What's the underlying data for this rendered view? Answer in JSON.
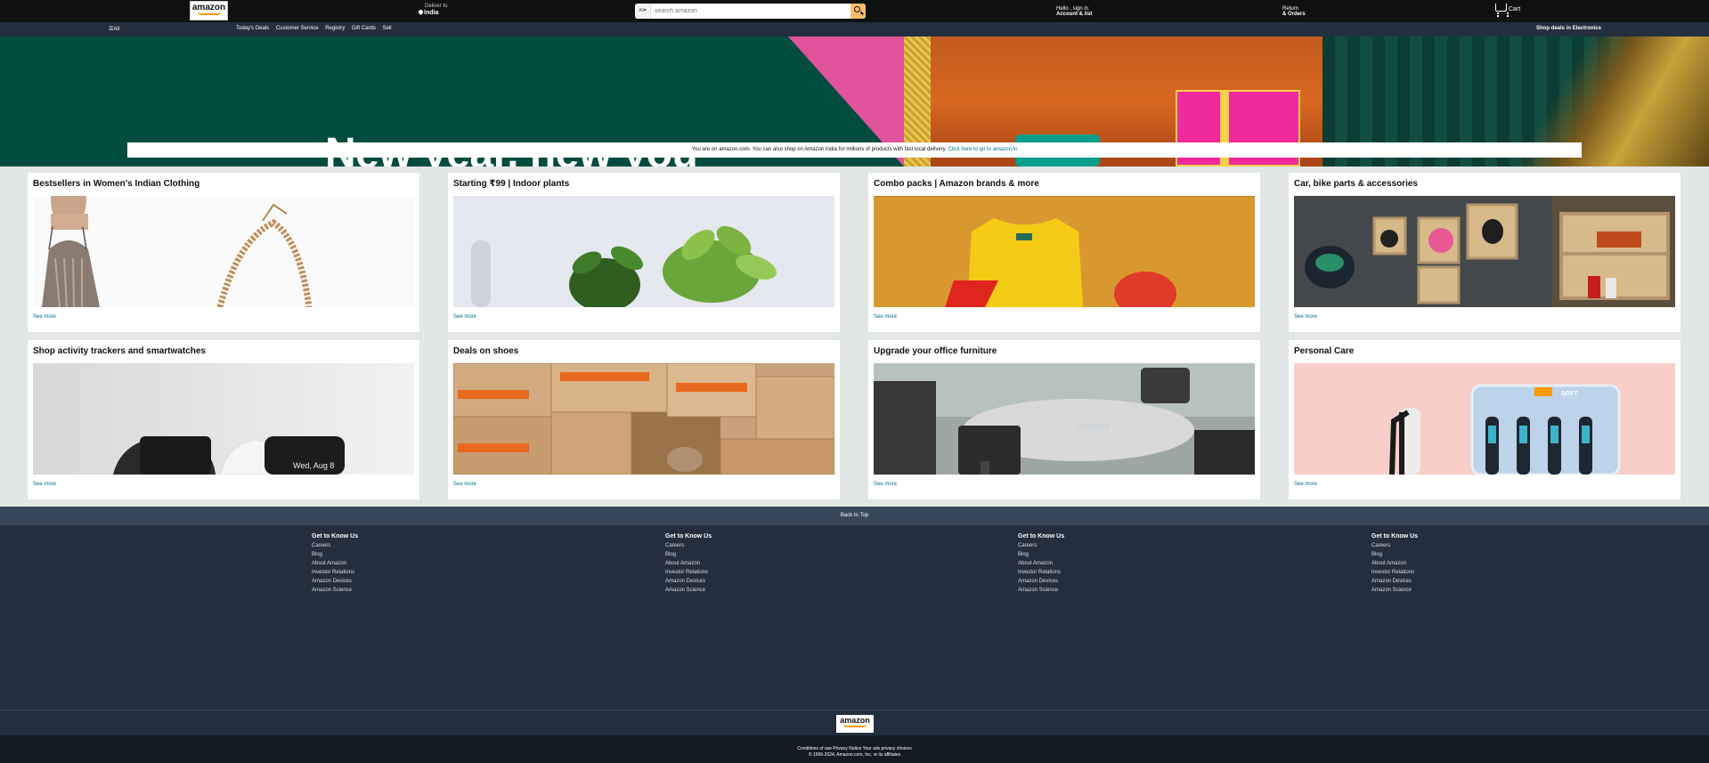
{
  "header": {
    "logo_text": "amazon",
    "deliver_label": "Deliver to",
    "deliver_location": "India",
    "search_category": "All",
    "search_placeholder": "search amazon",
    "account_line1": "Hello , sign in",
    "account_line2": "Account & list",
    "returns_line1": "Return",
    "returns_line2": "& Orders",
    "cart_label": "Cart"
  },
  "subnav": {
    "all_label": "All",
    "links": [
      "Today's Deals",
      "Customer Service",
      "Registry",
      "Gift Cards",
      "Sell"
    ],
    "promo": "Shop deals in Electronics"
  },
  "hero": {
    "headline": "New year, new you",
    "notice_text": "You are on amazon.com. You can also shop on Amazon India for millions of products with fast local delivery.",
    "notice_link": "Click here to go to amazon.in"
  },
  "cards": [
    {
      "title": "Bestsellers in Women's Indian Clothing",
      "see_more": "See more"
    },
    {
      "title": "Starting ₹99 | Indoor plants",
      "see_more": "See more"
    },
    {
      "title": "Combo packs | Amazon brands & more",
      "see_more": "See more"
    },
    {
      "title": "Car, bike parts & accessories",
      "see_more": "See more"
    },
    {
      "title": "Shop activity trackers and smartwatches",
      "see_more": "See more"
    },
    {
      "title": "Deals on shoes",
      "see_more": "See more"
    },
    {
      "title": "Upgrade your office furniture",
      "see_more": "See more"
    },
    {
      "title": "Personal Care",
      "see_more": "See more"
    }
  ],
  "watch_text": "Wed, Aug 8",
  "brush_label": "SOFT",
  "footer": {
    "back_to_top": "Back to Top",
    "columns": [
      {
        "heading": "Get to Know Us",
        "links": [
          "Careers",
          "Blog",
          "About Amazon",
          "Investor Relations",
          "Amazon Devices",
          "Amazon Science"
        ]
      },
      {
        "heading": "Get to Know Us",
        "links": [
          "Careers",
          "Blog",
          "About Amazon",
          "Investor Relations",
          "Amazon Devices",
          "Amazon Science"
        ]
      },
      {
        "heading": "Get to Know Us",
        "links": [
          "Careers",
          "Blog",
          "About Amazon",
          "Investor Relations",
          "Amazon Devices",
          "Amazon Science"
        ]
      },
      {
        "heading": "Get to Know Us",
        "links": [
          "Careers",
          "Blog",
          "About Amazon",
          "Investor Relations",
          "Amazon Devices",
          "Amazon Science"
        ]
      }
    ],
    "logo_text": "amazon",
    "legal_links": "Conditions of use Privacy Notice Your ads privacy choices",
    "copyright": "© 1996-2024, Amazon.com, Inc. or its affiliates"
  }
}
